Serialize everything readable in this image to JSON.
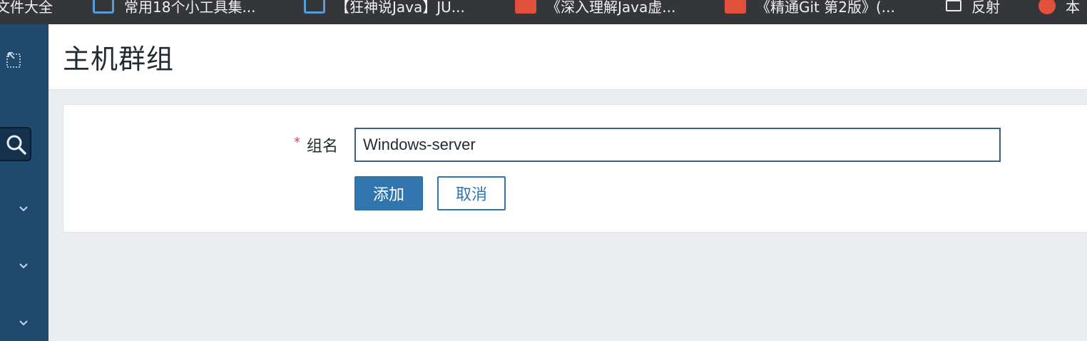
{
  "bookmarks": [
    {
      "label": "文件大全",
      "icon": "none"
    },
    {
      "label": "常用18个小工具集...",
      "icon": "bookmark-page-icon"
    },
    {
      "label": "【狂神说Java】JU...",
      "icon": "bookmark-page-icon"
    },
    {
      "label": "《深入理解Java虚...",
      "icon": "bookmark-red-icon"
    },
    {
      "label": "《精通Git 第2版》(...",
      "icon": "bookmark-red-icon"
    },
    {
      "label": "反射",
      "icon": "bookmark-edit-icon"
    },
    {
      "label": "本",
      "icon": "bookmark-heart-icon"
    }
  ],
  "sidebar": {
    "collapse_icon": "collapse-icon",
    "search_icon": "search-icon",
    "chevrons": [
      "chevron-down-icon",
      "chevron-down-icon",
      "chevron-down-icon"
    ]
  },
  "header": {
    "title": "主机群组"
  },
  "form": {
    "required_mark": "*",
    "group_name_label": "组名",
    "group_name_value": "Windows-server",
    "add_button": "添加",
    "cancel_button": "取消"
  },
  "colors": {
    "sidebar": "#1f4a6e",
    "primary": "#3075ad",
    "required": "#d64e4e",
    "bookmarks_bar": "#35363a"
  }
}
